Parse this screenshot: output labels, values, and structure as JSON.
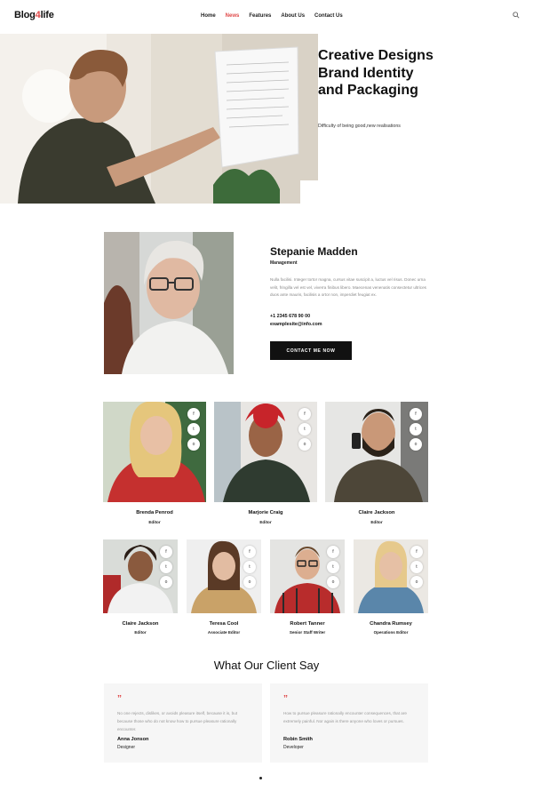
{
  "header": {
    "logo_left": "Blog",
    "logo_accent": "4",
    "logo_right": "life",
    "accent_color": "#e04a4a",
    "nav": [
      "Home",
      "News",
      "Features",
      "About Us",
      "Contact Us"
    ],
    "active_nav": "News",
    "search_icon": "search-icon"
  },
  "hero": {
    "title": "Creative Designs Brand Identity and Packaging",
    "subtitle": "Difficulty of being good,new realisations"
  },
  "profile": {
    "name": "Stepanie Madden",
    "role": "Management",
    "bio": "Nulla facilisi. Integer tortor magna, cursus vitae suscipit a, luctus vel risus. Donec urna velit, fringilla vel est vel, viverra finibus libero. Maecenas venenatis consectetur ultrices duos ante mauris, facilisis a ortor non, imperdiet feugiat ex.",
    "phone": "+1 2345 678 90 00",
    "email": "examplesite@info.com",
    "button": "CONTACT ME NOW"
  },
  "team_row1": [
    {
      "name": "Brenda Penrod",
      "role": "Editor"
    },
    {
      "name": "Marjorie Craig",
      "role": "Editor"
    },
    {
      "name": "Claire Jackson",
      "role": "Editor"
    }
  ],
  "team_row2": [
    {
      "name": "Claire Jackson",
      "role": "Editor"
    },
    {
      "name": "Teresa Cool",
      "role": "Associate Editor"
    },
    {
      "name": "Robert Tanner",
      "role": "Senior Staff Writer"
    },
    {
      "name": "Chandra  Rumsey",
      "role": "Operations Editor"
    }
  ],
  "social": {
    "facebook": "f",
    "twitter": "t",
    "instagram": "o"
  },
  "testimonials": {
    "title": "What Our Client Say",
    "quote_mark": "”",
    "items": [
      {
        "text": "No one rejects, dislikes, or avoids pleasure itself, because it is, but because those who do not know how to pursue pleasure rationally encounter.",
        "name": "Anna Jonson",
        "role": "Designer"
      },
      {
        "text": "How to pursue pleasure rationally encounter consequences, that are extremely painful. Nor again is there anyone who loves or pursues.",
        "name": "Robin Smith",
        "role": "Developer"
      }
    ]
  }
}
